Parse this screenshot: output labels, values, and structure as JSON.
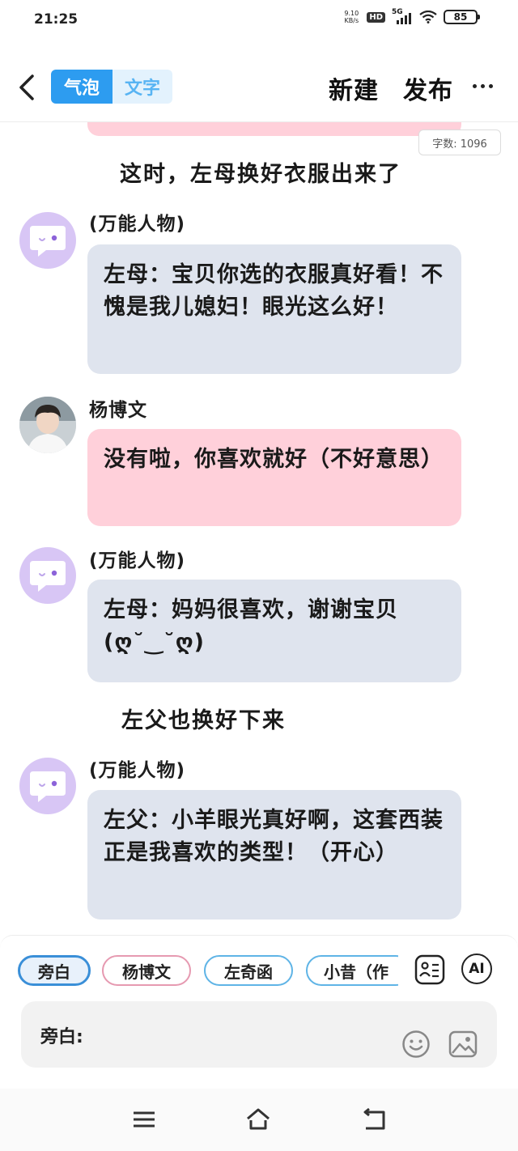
{
  "status_bar": {
    "time": "21:25",
    "net_speed_value": "9.10",
    "net_speed_unit": "KB/s",
    "hd": "HD",
    "network": "5G",
    "battery": "85"
  },
  "header": {
    "tab_bubble": "气泡",
    "tab_text": "文字",
    "new_label": "新建",
    "publish_label": "发布"
  },
  "word_count": "字数: 1096",
  "messages": [
    {
      "kind": "narration",
      "text": "这时，左母换好衣服出来了"
    },
    {
      "kind": "bubble",
      "speaker": "(万能人物)",
      "avatar": "universal",
      "text": "左母：宝贝你选的衣服真好看！不愧是我儿媳妇！眼光这么好！"
    },
    {
      "kind": "bubble",
      "speaker": "杨博文",
      "avatar": "photo",
      "text": "没有啦，你喜欢就好（不好意思）"
    },
    {
      "kind": "bubble",
      "speaker": "(万能人物)",
      "avatar": "universal",
      "text": "左母：妈妈很喜欢，谢谢宝贝(ღ˘‿˘ღ)"
    },
    {
      "kind": "narration",
      "text": "左父也换好下来"
    },
    {
      "kind": "bubble",
      "speaker": "(万能人物)",
      "avatar": "universal",
      "text": "左父：小羊眼光真好啊，这套西装正是我喜欢的类型！（开心）"
    }
  ],
  "roles": [
    "旁白",
    "杨博文",
    "左奇函",
    "小昔（作"
  ],
  "ai_label": "AI",
  "input": {
    "label": "旁白:"
  },
  "colors": {
    "accent": "#2d9cf0",
    "pink_bubble": "#ffd0da",
    "gray_bubble": "#dfe4ee",
    "avatar_purple": "#d8c6f5"
  },
  "icons": [
    "back-icon",
    "more-icon",
    "universal-character-icon",
    "role-card-icon",
    "ai-icon",
    "emoji-icon",
    "image-icon",
    "nav-menu-icon",
    "nav-home-icon",
    "nav-back-icon"
  ]
}
